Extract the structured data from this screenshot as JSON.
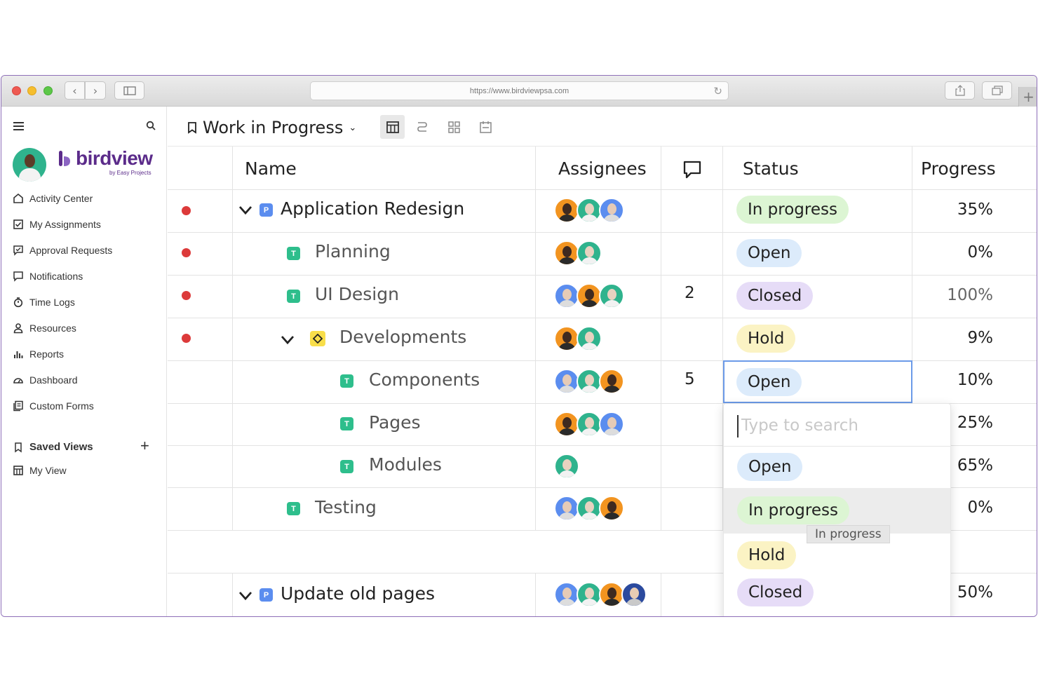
{
  "browser": {
    "url": "https://www.birdviewpsa.com"
  },
  "brand": {
    "name": "birdview",
    "tagline": "by Easy Projects",
    "color": "#5b2b8a"
  },
  "sidebar": {
    "items": [
      {
        "label": "Activity Center",
        "icon": "home-icon"
      },
      {
        "label": "My Assignments",
        "icon": "checkbox-icon"
      },
      {
        "label": "Approval Requests",
        "icon": "approval-icon"
      },
      {
        "label": "Notifications",
        "icon": "comment-icon"
      },
      {
        "label": "Time Logs",
        "icon": "stopwatch-icon"
      },
      {
        "label": "Resources",
        "icon": "person-icon"
      },
      {
        "label": "Reports",
        "icon": "bar-chart-icon"
      },
      {
        "label": "Dashboard",
        "icon": "gauge-icon"
      },
      {
        "label": "Custom Forms",
        "icon": "forms-icon"
      }
    ],
    "saved_views_label": "Saved Views",
    "saved_views": [
      {
        "label": "My View",
        "icon": "table-icon"
      }
    ]
  },
  "view": {
    "title": "Work in Progress"
  },
  "table": {
    "headers": {
      "name": "Name",
      "assignees": "Assignees",
      "status": "Status",
      "progress": "Progress"
    },
    "rows": [
      {
        "name": "Application Redesign",
        "type": "P",
        "comments": "",
        "status": "In progress",
        "progress": "35%",
        "flag": true
      },
      {
        "name": "Planning",
        "type": "T",
        "comments": "",
        "status": "Open",
        "progress": "0%",
        "flag": true
      },
      {
        "name": "UI Design",
        "type": "T",
        "comments": "2",
        "status": "Closed",
        "progress": "100%",
        "flag": true
      },
      {
        "name": "Developments",
        "type": "M",
        "comments": "",
        "status": "Hold",
        "progress": "9%",
        "flag": true
      },
      {
        "name": "Components",
        "type": "T",
        "comments": "5",
        "status": "Open",
        "progress": "10%",
        "flag": false
      },
      {
        "name": "Pages",
        "type": "T",
        "comments": "",
        "status": "",
        "progress": "25%",
        "flag": false
      },
      {
        "name": "Modules",
        "type": "T",
        "comments": "",
        "status": "",
        "progress": "65%",
        "flag": false
      },
      {
        "name": "Testing",
        "type": "T",
        "comments": "",
        "status": "",
        "progress": "0%",
        "flag": false
      },
      {
        "name": "Update old pages",
        "type": "P",
        "comments": "",
        "status": "Closed",
        "progress": "50%",
        "flag": false
      }
    ]
  },
  "status_dropdown": {
    "placeholder": "Type to search",
    "options": [
      "Open",
      "In progress",
      "Hold",
      "Closed"
    ],
    "tooltip": "In progress"
  },
  "status_colors": {
    "In progress": "#dcf5d3",
    "Open": "#dcebfb",
    "Closed": "#e6dcf7",
    "Hold": "#fbf3c4"
  }
}
